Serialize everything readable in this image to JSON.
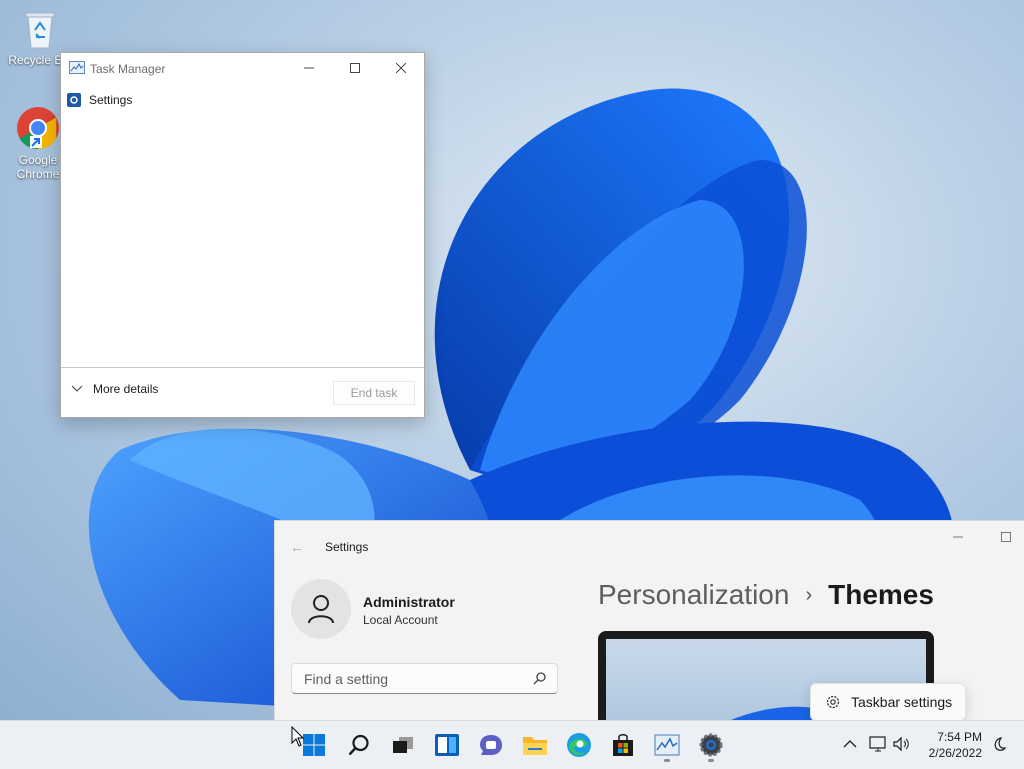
{
  "desktop": {
    "icons": [
      {
        "name": "recycle-bin",
        "label": "Recycle Bin"
      },
      {
        "name": "google-chrome",
        "label": "Google Chrome"
      }
    ]
  },
  "task_manager": {
    "title": "Task Manager",
    "processes": [
      {
        "label": "Settings",
        "icon": "settings-app-icon"
      }
    ],
    "more_details": "More details",
    "end_task": "End task"
  },
  "settings": {
    "title": "Settings",
    "account": {
      "name": "Administrator",
      "type": "Local Account"
    },
    "search": {
      "placeholder": "Find a setting",
      "value": ""
    },
    "breadcrumb": {
      "parent": "Personalization",
      "separator": "›",
      "current": "Themes"
    }
  },
  "tooltip": {
    "label": "Taskbar settings"
  },
  "taskbar": {
    "apps": [
      "start-icon",
      "search-icon",
      "task-view-icon",
      "widgets-icon",
      "teams-chat-icon",
      "file-explorer-icon",
      "edge-icon",
      "store-icon",
      "task-manager-icon",
      "settings-icon"
    ],
    "clock": {
      "time": "7:54 PM",
      "date": "2/26/2022"
    }
  }
}
